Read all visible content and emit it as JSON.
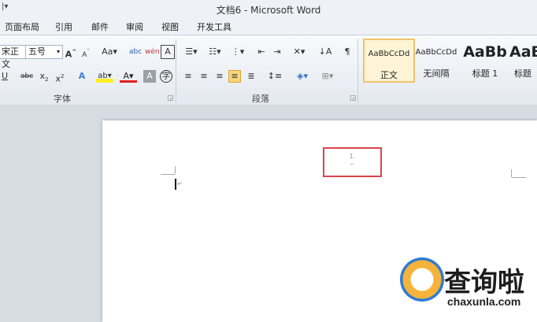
{
  "window": {
    "title": "文档6 - Microsoft Word",
    "qat_icon": "dropdown-arrow-icon"
  },
  "menu": [
    "页面布局",
    "引用",
    "邮件",
    "审阅",
    "视图",
    "开发工具"
  ],
  "font_group": {
    "font_name": "宋正文",
    "font_size": "五号",
    "label": "字体",
    "row1_icons": [
      "grow-font-icon",
      "shrink-font-icon",
      "change-case-icon",
      "phonetic-guide-icon",
      "clear-format-icon",
      "char-border-icon"
    ],
    "row2_icons": [
      "underline-icon",
      "strikethrough-icon",
      "subscript-icon",
      "superscript-icon",
      "text-effect-icon",
      "highlight-icon",
      "font-color-icon",
      "char-shading-icon",
      "enclose-char-icon"
    ]
  },
  "paragraph_group": {
    "label": "段落",
    "row1_icons": [
      "bullets-icon",
      "numbering-icon",
      "multilevel-list-icon",
      "decrease-indent-icon",
      "increase-indent-icon",
      "chinese-layout-icon",
      "sort-icon",
      "show-marks-icon"
    ],
    "row2_icons": [
      "align-left-icon",
      "center-icon",
      "align-right-icon",
      "justify-icon",
      "distribute-icon",
      "line-spacing-icon",
      "shading-icon",
      "borders-icon"
    ]
  },
  "styles_group": {
    "tiles": [
      {
        "sample": "AaBbCcDd",
        "name": "正文",
        "selected": true
      },
      {
        "sample": "AaBbCcDd",
        "name": "无间隔",
        "selected": false
      },
      {
        "sample": "AaBb",
        "name": "标题 1",
        "selected": false
      },
      {
        "sample": "AaB",
        "name": "标题",
        "selected": false
      }
    ]
  },
  "document": {
    "highlight_text": "1.",
    "highlight_color": "#d9444d"
  },
  "watermark": {
    "name": "查询啦",
    "url": "chaxunla.com"
  }
}
